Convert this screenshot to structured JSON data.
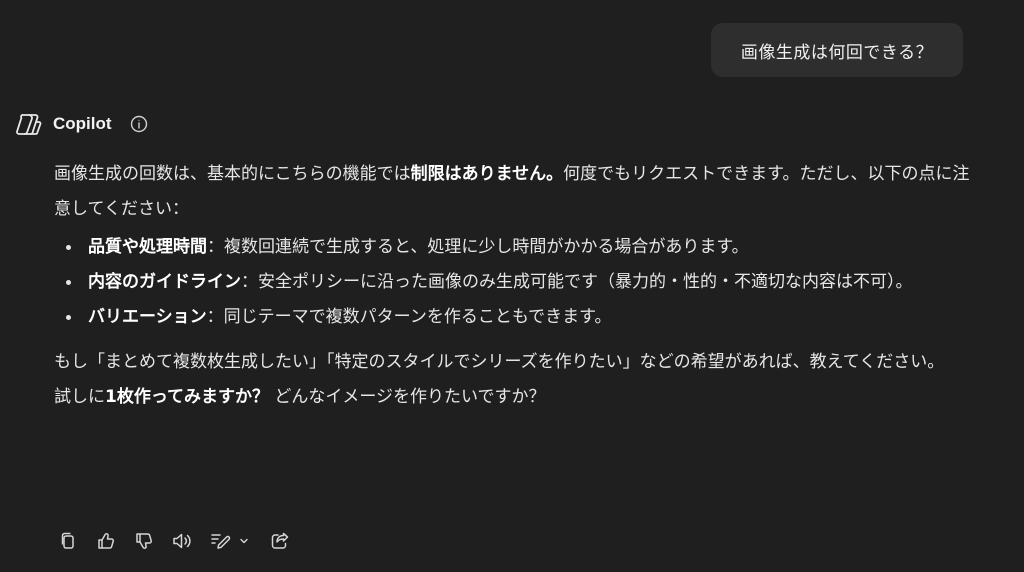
{
  "user_message": "画像生成は何回できる？",
  "assistant": {
    "name": "Copilot",
    "icons": {
      "logo": "copilot-logo",
      "info": "info-icon"
    }
  },
  "response": {
    "para1": {
      "a": "画像生成の回数は、基本的にこちらの機能では",
      "b": "制限はありません。",
      "c": "何度でもリクエストできます。ただし、以下の点に注意してください："
    },
    "bullets": [
      {
        "title": "品質や処理時間",
        "text": "：複数回連続で生成すると、処理に少し時間がかかる場合があります。"
      },
      {
        "title": "内容のガイドライン",
        "text": "：安全ポリシーに沿った画像のみ生成可能です（暴力的・性的・不適切な内容は不可）。"
      },
      {
        "title": "バリエーション",
        "text": "：同じテーマで複数パターンを作ることもできます。"
      }
    ],
    "para2": "もし「まとめて複数枚生成したい」「特定のスタイルでシリーズを作りたい」などの希望があれば、教えてください。",
    "para3": {
      "a": "試しに",
      "b": "1枚作ってみますか？",
      "c": " どんなイメージを作りたいですか？"
    }
  },
  "toolbar": {
    "icons": [
      "copy-icon",
      "thumbs-up-icon",
      "thumbs-down-icon",
      "speaker-icon",
      "edit-icon",
      "chevron-down-icon",
      "share-icon"
    ]
  },
  "colors": {
    "background": "#1f1f1f",
    "bubble": "#2e2e2e",
    "text": "#e6e6e6"
  }
}
